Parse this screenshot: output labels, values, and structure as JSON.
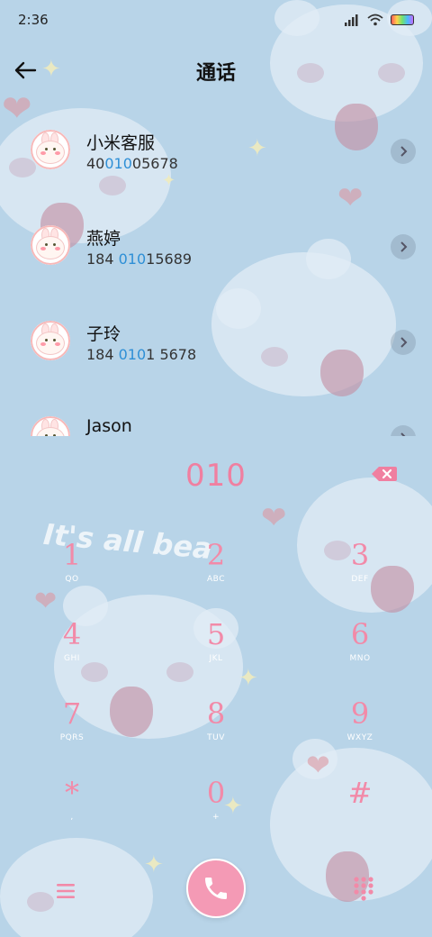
{
  "status_bar": {
    "time": "2:36"
  },
  "header": {
    "title": "通话"
  },
  "contacts": [
    {
      "name": "小米客服",
      "number_pre": "40",
      "number_hl": "010",
      "number_post": "05678"
    },
    {
      "name": "燕婷",
      "number_pre": "184 ",
      "number_hl": "010",
      "number_post": "15689"
    },
    {
      "name": "子玲",
      "number_pre": "184 ",
      "number_hl": "010",
      "number_post": "1 5678"
    },
    {
      "name": "Jason"
    }
  ],
  "dialer": {
    "input": "010"
  },
  "wallpaper_text": "It's all bea",
  "keypad": [
    {
      "digit": "1",
      "letters": "QO"
    },
    {
      "digit": "2",
      "letters": "ABC"
    },
    {
      "digit": "3",
      "letters": "DEF"
    },
    {
      "digit": "4",
      "letters": "GHI"
    },
    {
      "digit": "5",
      "letters": "JKL"
    },
    {
      "digit": "6",
      "letters": "MNO"
    },
    {
      "digit": "7",
      "letters": "PQRS"
    },
    {
      "digit": "8",
      "letters": "TUV"
    },
    {
      "digit": "9",
      "letters": "WXYZ"
    },
    {
      "digit": "*",
      "letters": ","
    },
    {
      "digit": "0",
      "letters": "+"
    },
    {
      "digit": "#",
      "letters": ""
    }
  ],
  "colors": {
    "accent": "#f07fa0",
    "highlight": "#2e8fd6",
    "background": "#b8d4e8"
  }
}
